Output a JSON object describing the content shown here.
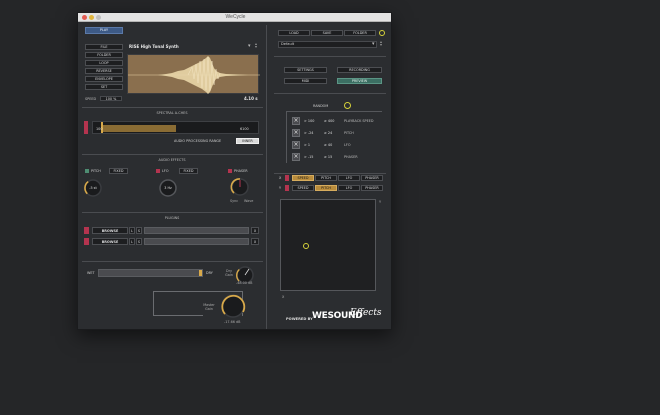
{
  "window": {
    "title": "WeCycle"
  },
  "colors": {
    "accent_gold": "#c9a25a",
    "accent_blue": "#3d5a86",
    "accent_teal": "#3c6f63",
    "accent_red": "#b4344f",
    "yellow": "#d6d23a"
  },
  "left": {
    "play_label": "PLAY",
    "side_buttons": [
      "FILE",
      "FOLDER",
      "LOOP",
      "REVERSE",
      "ENVELOPE",
      "SET"
    ],
    "sample_name": "RISE High Tonal Synth",
    "speed_label": "SPEED",
    "speed_value": "100 %",
    "duration": "4.10 s",
    "spectral_title": "SPECTRAL A-CHES",
    "range_low": "100",
    "range_high": "6100",
    "audio_range_label": "AUDIO PROCESSING RANGE",
    "audio_range_mode": "INNER",
    "effects_title": "AUDIO EFFECTS",
    "pitch_label": "PITCH",
    "pitch_mode": "FIXED",
    "pitch_value": "-5 st",
    "lfo_label": "LFO",
    "lfo_mode": "FIXED",
    "lfo_value": "3 Hz",
    "phaser_label": "PHASER",
    "phaser_sub_left": "Sync",
    "phaser_sub_right": "Wave",
    "plugins_title": "PLUGINS",
    "plugins": [
      {
        "browse": "BROWSE",
        "l": "L",
        "s": "S",
        "x": "X"
      },
      {
        "browse": "BROWSE",
        "l": "L",
        "s": "S",
        "x": "X"
      }
    ],
    "wet_label": "WET",
    "dry_label": "DRY",
    "dry_knob_label": "Dry Gain",
    "dry_knob_value": "-48.00 dB",
    "master_label": "Master Gain",
    "master_value": "-17.66 dB"
  },
  "right": {
    "tabs": [
      "LOAD",
      "SAVE",
      "FOLDER"
    ],
    "preset": "Default",
    "settings_label": "SETTINGS",
    "midi_label": "MIDI",
    "recording_label": "RECORDING",
    "preview_label": "PREVIEW",
    "random_label": "RANDOM",
    "random_rows": [
      {
        "min": "> 100",
        "max": "≥ 400",
        "name": "PLAYBACK SPEED"
      },
      {
        "min": "> -24",
        "max": "≥ 24",
        "name": "PITCH"
      },
      {
        "min": "> 1",
        "max": "≥ 40",
        "name": "LFO"
      },
      {
        "min": "> -15",
        "max": "≥ 15",
        "name": "PHASER"
      }
    ],
    "x_axis_label": "X",
    "y_axis_label": "Y",
    "x_buttons": [
      "SPEED",
      "PITCH",
      "LFO",
      "PHASER"
    ],
    "y_buttons": [
      "SPEED",
      "PITCH",
      "LFO",
      "PHASER"
    ],
    "pad_y_label": "Y",
    "pad_x_label": "X",
    "powered_by": "POWERED BY",
    "brand": "WESOUND",
    "brand_script": "Effects"
  }
}
